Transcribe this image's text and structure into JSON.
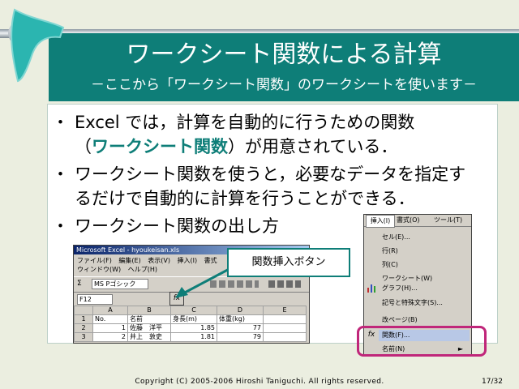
{
  "slide": {
    "title": "ワークシート関数による計算",
    "subtitle": "－ここから「ワークシート関数」のワークシートを使います－",
    "bullet_mark": "・",
    "bullets": [
      {
        "line1_pre": "Excel では，計算を自動的に行うための関数",
        "line2_open": "（",
        "line2_hl": "ワークシート関数",
        "line2_post": "）が用意されている．"
      },
      {
        "line1": "ワークシート関数を使うと，必要なデータを指定す",
        "line2": "るだけで自動的に計算を行うことができる．"
      },
      {
        "line1": "ワークシート関数の出し方"
      }
    ],
    "callout": "関数挿入ボタン",
    "footer": "Copyright (C) 2005-2006 Hiroshi Taniguchi. All rights reserved.",
    "page": "17/32"
  },
  "excel": {
    "window_title": "Microsoft Excel - hyoukeisan.xls",
    "menu_row1": [
      "ファイル(F)",
      "編集(E)",
      "表示(V)",
      "挿入(I)",
      "書式"
    ],
    "menu_row2": [
      "ウィンドウ(W)",
      "ヘルプ(H)"
    ],
    "sigma": "Σ",
    "font_name": "MS Pゴシック",
    "name_box": "F12",
    "fx": "fx",
    "columns": [
      "",
      "A",
      "B",
      "C",
      "D",
      "E"
    ],
    "rows": [
      [
        "1",
        "No.",
        "名前",
        "身長(m)",
        "体重(kg)",
        ""
      ],
      [
        "2",
        "1",
        "佐藤　洋平",
        "1.85",
        "77",
        ""
      ],
      [
        "3",
        "2",
        "井上　敦史",
        "1.81",
        "79",
        ""
      ]
    ]
  },
  "insert_menu": {
    "bar": [
      "挿入(I)",
      "書式(O)",
      "ツール(T)"
    ],
    "items": [
      "セル(E)...",
      "行(R)",
      "列(C)",
      "ワークシート(W)",
      "グラフ(H)...",
      "記号と特殊文字(S)...",
      "改ページ(B)",
      "関数(F)...",
      "名前(N)"
    ],
    "submenu_arrow": "►"
  }
}
